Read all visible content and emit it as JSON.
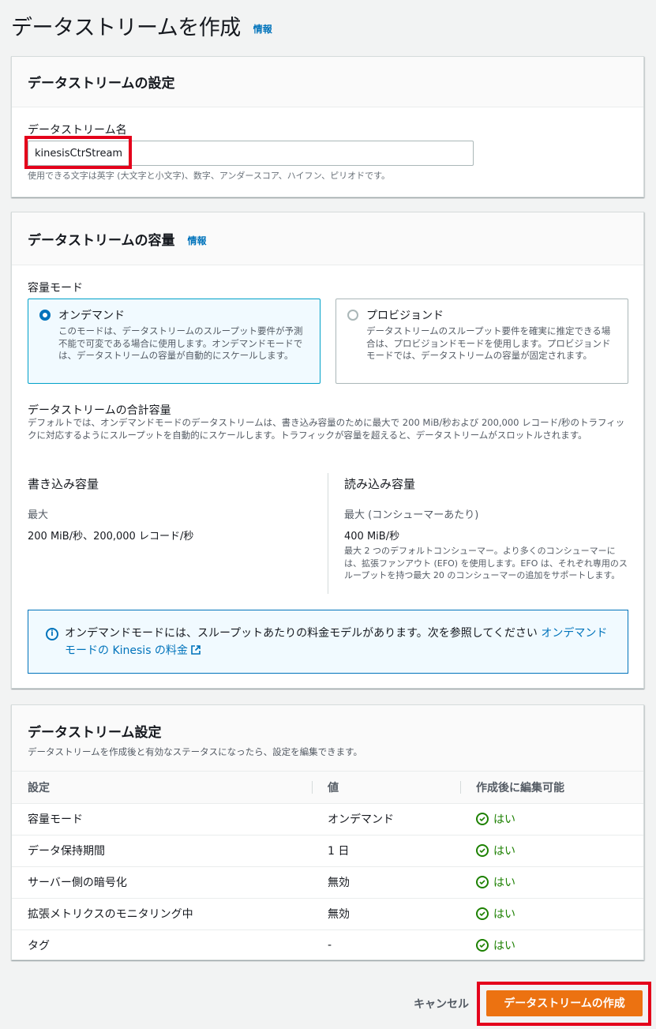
{
  "header": {
    "title": "データストリームを作成",
    "info": "情報"
  },
  "stream_config": {
    "title": "データストリームの設定",
    "name_label": "データストリーム名",
    "name_value": "kinesisCtrStream",
    "name_hint": "使用できる文字は英字 (大文字と小文字)、数字、アンダースコア、ハイフン、ピリオドです。"
  },
  "capacity": {
    "title": "データストリームの容量",
    "info": "情報",
    "mode_label": "容量モード",
    "modes": [
      {
        "label": "オンデマンド",
        "desc": "このモードは、データストリームのスループット要件が予測不能で可変である場合に使用します。オンデマンドモードでは、データストリームの容量が自動的にスケールします。",
        "selected": true
      },
      {
        "label": "プロビジョンド",
        "desc": "データストリームのスループット要件を確実に推定できる場合は、プロビジョンドモードを使用します。プロビジョンドモードでは、データストリームの容量が固定されます。",
        "selected": false
      }
    ],
    "total_title": "データストリームの合計容量",
    "total_desc": "デフォルトでは、オンデマンドモードのデータストリームは、書き込み容量のために最大で 200 MiB/秒および 200,000 レコード/秒のトラフィックに対応するようにスループットを自動的にスケールします。トラフィックが容量を超えると、データストリームがスロットルされます。",
    "write": {
      "title": "書き込み容量",
      "label": "最大",
      "value": "200 MiB/秒、200,000 レコード/秒"
    },
    "read": {
      "title": "読み込み容量",
      "label": "最大 (コンシューマーあたり)",
      "value": "400 MiB/秒",
      "note": "最大 2 つのデフォルトコンシューマー。より多くのコンシューマーには、拡張ファンアウト (EFO) を使用します。EFO は、それぞれ専用のスループットを持つ最大 20 のコンシューマーの追加をサポートします。"
    },
    "alert_text_1": "オンデマンドモードには、スループットあたりの料金モデルがあります。次を参照してください",
    "alert_link": "オンデマンドモードの Kinesis の料金"
  },
  "stream_settings": {
    "title": "データストリーム設定",
    "subtitle": "データストリームを作成後と有効なステータスになったら、設定を編集できます。",
    "columns": [
      "設定",
      "値",
      "作成後に編集可能"
    ],
    "rows": [
      {
        "setting": "容量モード",
        "value": "オンデマンド",
        "editable": "はい"
      },
      {
        "setting": "データ保持期間",
        "value": "1 日",
        "editable": "はい"
      },
      {
        "setting": "サーバー側の暗号化",
        "value": "無効",
        "editable": "はい"
      },
      {
        "setting": "拡張メトリクスのモニタリング中",
        "value": "無効",
        "editable": "はい"
      },
      {
        "setting": "タグ",
        "value": "-",
        "editable": "はい"
      }
    ]
  },
  "footer": {
    "cancel": "キャンセル",
    "create": "データストリームの作成"
  },
  "colors": {
    "accent": "#0073bb",
    "primary_button": "#ec7211",
    "highlight_box": "#e4001b",
    "success": "#1d8102"
  }
}
